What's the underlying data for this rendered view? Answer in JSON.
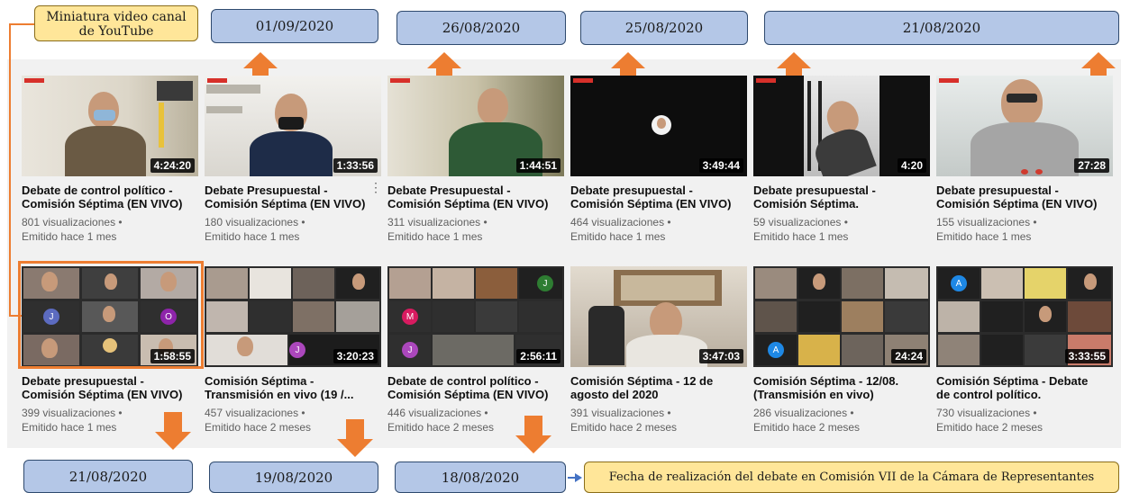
{
  "annotations": {
    "note_thumbnail": "Miniatura video canal de YouTube",
    "note_thumbnail_line1": "Miniatura video canal",
    "note_thumbnail_line2": "de YouTube",
    "note_date": "Fecha de realización del debate en Comisión VII de la Cámara de Representantes",
    "top_dates": [
      "01/09/2020",
      "26/08/2020",
      "25/08/2020",
      "21/08/2020"
    ],
    "bottom_dates": [
      "21/08/2020",
      "19/08/2020",
      "18/08/2020"
    ]
  },
  "videos": {
    "row1": [
      {
        "title1": "Debate de control político -",
        "title2": "Comisión Séptima (EN VIVO)",
        "views": "801 visualizaciones •",
        "age": "Emitido hace 1 mes",
        "duration": "4:24:20"
      },
      {
        "title1": "Debate Presupuestal -",
        "title2": "Comisión Séptima (EN VIVO)",
        "views": "180 visualizaciones •",
        "age": "Emitido hace 1 mes",
        "duration": "1:33:56"
      },
      {
        "title1": "Debate Presupuestal -",
        "title2": "Comisión Séptima (EN VIVO)",
        "views": "311 visualizaciones •",
        "age": "Emitido hace 1 mes",
        "duration": "1:44:51"
      },
      {
        "title1": "Debate presupuestal -",
        "title2": "Comisión Séptima (EN VIVO)",
        "views": "464 visualizaciones •",
        "age": "Emitido hace 1 mes",
        "duration": "3:49:44"
      },
      {
        "title1": "Debate presupuestal -",
        "title2": "Comisión Séptima.",
        "views": "59 visualizaciones •",
        "age": "Emitido hace 1 mes",
        "duration": "4:20"
      },
      {
        "title1": "Debate presupuestal -",
        "title2": "Comisión Séptima (EN VIVO)",
        "views": "155 visualizaciones •",
        "age": "Emitido hace 1 mes",
        "duration": "27:28"
      }
    ],
    "row2": [
      {
        "title1": "Debate presupuestal -",
        "title2": "Comisión Séptima (EN VIVO)",
        "views": "399 visualizaciones •",
        "age": "Emitido hace 1 mes",
        "duration": "1:58:55"
      },
      {
        "title1": "Comisión Séptima -",
        "title2": "Transmisión en vivo (19 /...",
        "views": "457 visualizaciones •",
        "age": "Emitido hace 2 meses",
        "duration": "3:20:23"
      },
      {
        "title1": "Debate de control político -",
        "title2": "Comisión Séptima (EN VIVO)",
        "views": "446 visualizaciones •",
        "age": "Emitido hace 2 meses",
        "duration": "2:56:11"
      },
      {
        "title1": "Comisión Séptima - 12 de",
        "title2": "agosto del 2020",
        "views": "391 visualizaciones •",
        "age": "Emitido hace 2 meses",
        "duration": "3:47:03"
      },
      {
        "title1": "Comisión Séptima - 12/08.",
        "title2": "(Transmisión en vivo)",
        "views": "286 visualizaciones •",
        "age": "Emitido hace 2 meses",
        "duration": "24:24"
      },
      {
        "title1": "Comisión Séptima - Debate",
        "title2": "de control político.",
        "views": "730 visualizaciones •",
        "age": "Emitido hace 2 meses",
        "duration": "3:33:55"
      }
    ]
  },
  "avatars": {
    "j": "J",
    "o": "O",
    "m": "M",
    "a": "A"
  },
  "colors": {
    "accent_orange": "#ed7d31",
    "date_box": "#b4c7e7",
    "note_box": "#ffe699"
  }
}
